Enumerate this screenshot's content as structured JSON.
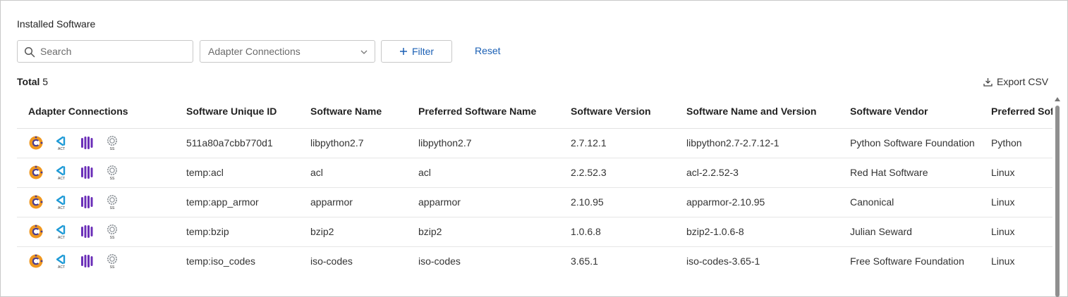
{
  "title": "Installed Software",
  "search": {
    "placeholder": "Search",
    "value": ""
  },
  "adapter_select": {
    "value": "Adapter Connections"
  },
  "filter_label": "Filter",
  "reset_label": "Reset",
  "total": {
    "label": "Total",
    "count": "5"
  },
  "export_label": "Export CSV",
  "columns": [
    "Adapter Connections",
    "Software Unique ID",
    "Software Name",
    "Preferred Software Name",
    "Software Version",
    "Software Name and Version",
    "Software Vendor",
    "Preferred Software Vendor"
  ],
  "adapter_icons": [
    "chef-adapter-icon",
    "act-adapter-icon",
    "cloud-adapter-icon",
    "ss-adapter-icon"
  ],
  "adapter_icon_text": {
    "act": "ACT",
    "ss": "SS"
  },
  "colors": {
    "accent": "#1a5fb4",
    "chef_orange": "#f09820",
    "act_blue": "#1e9ad6",
    "purple": "#6b2fb8"
  },
  "rows": [
    {
      "id": "511a80a7cbb770d1",
      "name": "libpython2.7",
      "preferred_name": "libpython2.7",
      "version": "2.7.12.1",
      "name_version": "libpython2.7-2.7.12-1",
      "vendor": "Python Software Foundation",
      "preferred_vendor": "Python"
    },
    {
      "id": "temp:acl",
      "name": "acl",
      "preferred_name": "acl",
      "version": "2.2.52.3",
      "name_version": "acl-2.2.52-3",
      "vendor": "Red Hat Software",
      "preferred_vendor": "Linux"
    },
    {
      "id": "temp:app_armor",
      "name": "apparmor",
      "preferred_name": "apparmor",
      "version": "2.10.95",
      "name_version": "apparmor-2.10.95",
      "vendor": "Canonical",
      "preferred_vendor": "Linux"
    },
    {
      "id": "temp:bzip",
      "name": "bzip2",
      "preferred_name": "bzip2",
      "version": "1.0.6.8",
      "name_version": "bzip2-1.0.6-8",
      "vendor": "Julian Seward",
      "preferred_vendor": "Linux"
    },
    {
      "id": "temp:iso_codes",
      "name": "iso-codes",
      "preferred_name": "iso-codes",
      "version": "3.65.1",
      "name_version": "iso-codes-3.65-1",
      "vendor": "Free Software Foundation",
      "preferred_vendor": "Linux"
    }
  ]
}
